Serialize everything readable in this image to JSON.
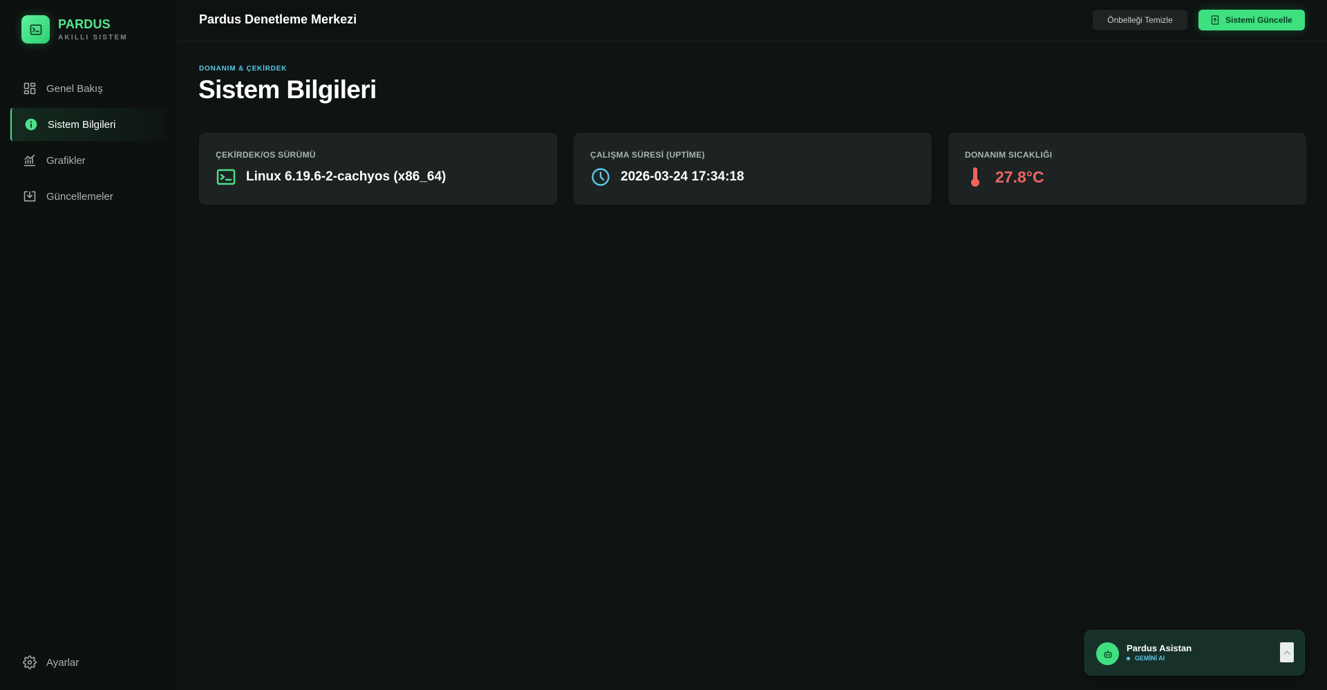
{
  "brand": {
    "title": "PARDUS",
    "subtitle": "AKILLI SISTEM",
    "icon": "terminal-icon"
  },
  "sidebar": {
    "items": [
      {
        "label": "Genel Bakış",
        "icon": "dashboard-grid-icon",
        "active": false
      },
      {
        "label": "Sistem Bilgileri",
        "icon": "info-icon",
        "active": true
      },
      {
        "label": "Grafikler",
        "icon": "chart-icon",
        "active": false
      },
      {
        "label": "Güncellemeler",
        "icon": "download-icon",
        "active": false
      }
    ],
    "settings_label": "Ayarlar",
    "settings_icon": "gear-icon"
  },
  "header": {
    "title": "Pardus Denetleme Merkezi",
    "clear_cache_label": "Önbelleği Temizle",
    "update_label": "Sistemi Güncelle",
    "update_icon": "update-icon"
  },
  "main": {
    "eyebrow": "DONANIM & ÇEKİRDEK",
    "title": "Sistem Bilgileri",
    "cards": [
      {
        "label": "ÇEKİRDEK/OS SÜRÜMÜ",
        "value": "Linux 6.19.6-2-cachyos (x86_64)",
        "icon": "terminal-icon"
      },
      {
        "label": "ÇALIŞMA SÜRESİ (UPTİME)",
        "value": "2026-03-24 17:34:18",
        "icon": "clock-icon"
      },
      {
        "label": "DONANIM SICAKLIĞI",
        "value": "27.8°C",
        "icon": "thermometer-icon"
      }
    ]
  },
  "assistant": {
    "name": "Pardus Asistan",
    "status": "GEMİNİ AI",
    "avatar_icon": "robot-icon",
    "toggle_icon": "chevron-up-icon"
  },
  "colors": {
    "accent": "#3ee07f",
    "info": "#5cc8e8",
    "danger": "#f06464",
    "background": "#0f1413",
    "card": "#1c2322"
  }
}
